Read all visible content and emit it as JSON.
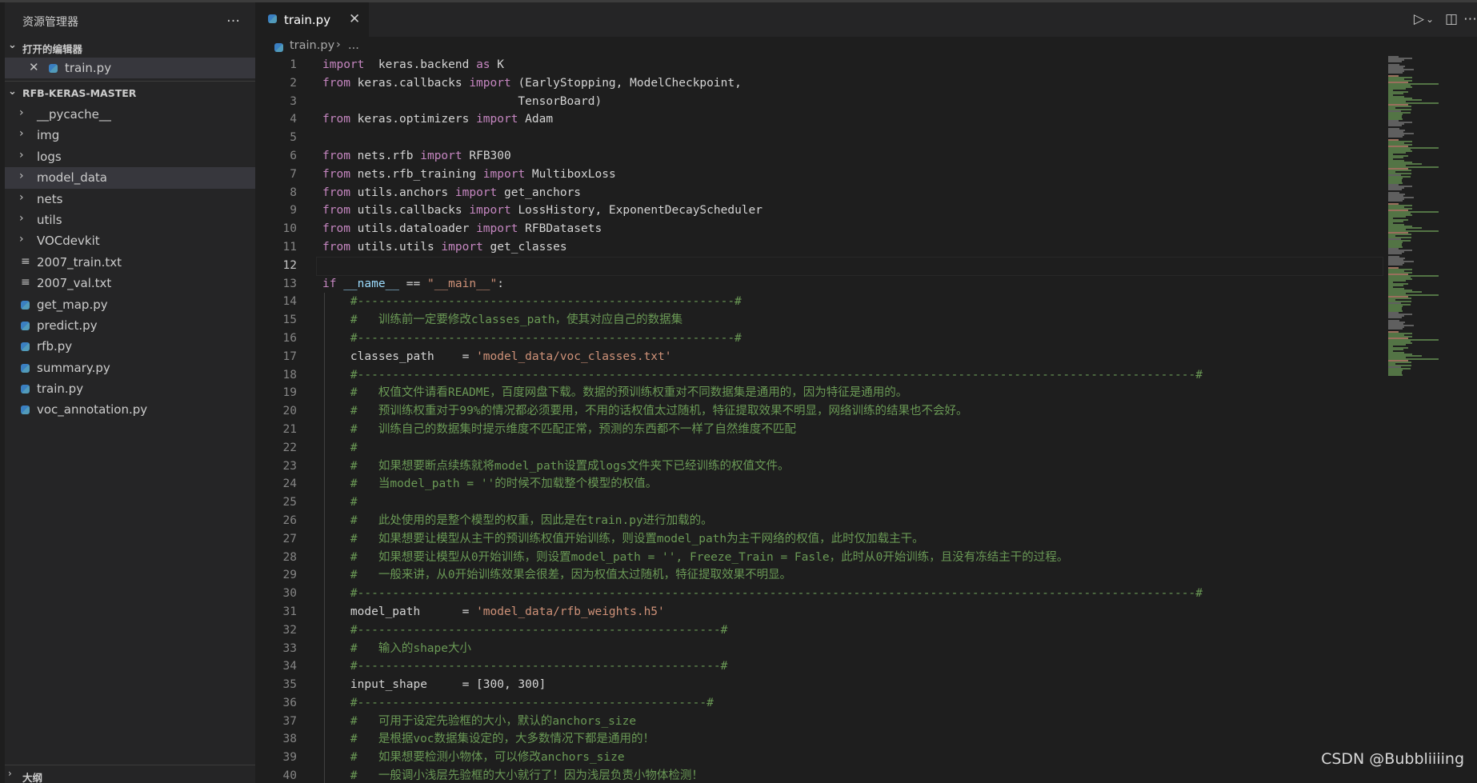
{
  "sidebar": {
    "title": "资源管理器",
    "more_icon": "…",
    "open_editors_label": "打开的编辑器",
    "open_editors": [
      {
        "name": "train.py"
      }
    ],
    "project_label": "RFB-KERAS-MASTER",
    "folders": [
      "__pycache__",
      "img",
      "logs",
      "model_data",
      "nets",
      "utils",
      "VOCdevkit"
    ],
    "files": [
      {
        "name": "2007_train.txt",
        "icon": "text-file-icon"
      },
      {
        "name": "2007_val.txt",
        "icon": "text-file-icon"
      },
      {
        "name": "get_map.py",
        "icon": "python-file-icon"
      },
      {
        "name": "predict.py",
        "icon": "python-file-icon"
      },
      {
        "name": "rfb.py",
        "icon": "python-file-icon"
      },
      {
        "name": "summary.py",
        "icon": "python-file-icon"
      },
      {
        "name": "train.py",
        "icon": "python-file-icon"
      },
      {
        "name": "voc_annotation.py",
        "icon": "python-file-icon"
      }
    ],
    "selected_item": "model_data",
    "outline_label": "大纲"
  },
  "editor": {
    "tab": {
      "label": "train.py",
      "close": "✕"
    },
    "breadcrumb": {
      "file": "train.py",
      "separator": "›",
      "more": "..."
    },
    "active_line": 12,
    "lines": [
      [
        [
          "kw2",
          "import"
        ],
        [
          "",
          "  keras.backend "
        ],
        [
          "kw2",
          "as"
        ],
        [
          "",
          " K"
        ]
      ],
      [
        [
          "kw2",
          "from"
        ],
        [
          "",
          " keras.callbacks "
        ],
        [
          "kw2",
          "import"
        ],
        [
          "",
          " (EarlyStopping, ModelCheckpoint,"
        ]
      ],
      [
        [
          "",
          "                            TensorBoard)"
        ]
      ],
      [
        [
          "kw2",
          "from"
        ],
        [
          "",
          " keras.optimizers "
        ],
        [
          "kw2",
          "import"
        ],
        [
          "",
          " Adam"
        ]
      ],
      [],
      [
        [
          "kw2",
          "from"
        ],
        [
          "",
          " nets.rfb "
        ],
        [
          "kw2",
          "import"
        ],
        [
          "",
          " RFB300"
        ]
      ],
      [
        [
          "kw2",
          "from"
        ],
        [
          "",
          " nets.rfb_training "
        ],
        [
          "kw2",
          "import"
        ],
        [
          "",
          " MultiboxLoss"
        ]
      ],
      [
        [
          "kw2",
          "from"
        ],
        [
          "",
          " utils.anchors "
        ],
        [
          "kw2",
          "import"
        ],
        [
          "",
          " get_anchors"
        ]
      ],
      [
        [
          "kw2",
          "from"
        ],
        [
          "",
          " utils.callbacks "
        ],
        [
          "kw2",
          "import"
        ],
        [
          "",
          " LossHistory, ExponentDecayScheduler"
        ]
      ],
      [
        [
          "kw2",
          "from"
        ],
        [
          "",
          " utils.dataloader "
        ],
        [
          "kw2",
          "import"
        ],
        [
          "",
          " RFBDatasets"
        ]
      ],
      [
        [
          "kw2",
          "from"
        ],
        [
          "",
          " utils.utils "
        ],
        [
          "kw2",
          "import"
        ],
        [
          "",
          " get_classes"
        ]
      ],
      [],
      [
        [
          "kw2",
          "if"
        ],
        [
          "",
          " "
        ],
        [
          "var",
          "__name__"
        ],
        [
          "",
          " == "
        ],
        [
          "str",
          "\"__main__\""
        ],
        [
          "",
          ":"
        ]
      ],
      [
        [
          "",
          "    "
        ],
        [
          "cm",
          "#------------------------------------------------------#"
        ]
      ],
      [
        [
          "",
          "    "
        ],
        [
          "cm",
          "#   训练前一定要修改classes_path，使其对应自己的数据集"
        ]
      ],
      [
        [
          "",
          "    "
        ],
        [
          "cm",
          "#------------------------------------------------------#"
        ]
      ],
      [
        [
          "",
          "    classes_path    = "
        ],
        [
          "str",
          "'model_data/voc_classes.txt'"
        ]
      ],
      [
        [
          "",
          "    "
        ],
        [
          "cm",
          "#------------------------------------------------------------------------------------------------------------------------#"
        ]
      ],
      [
        [
          "",
          "    "
        ],
        [
          "cm",
          "#   权值文件请看README，百度网盘下载。数据的预训练权重对不同数据集是通用的，因为特征是通用的。"
        ]
      ],
      [
        [
          "",
          "    "
        ],
        [
          "cm",
          "#   预训练权重对于99%的情况都必须要用，不用的话权值太过随机，特征提取效果不明显，网络训练的结果也不会好。"
        ]
      ],
      [
        [
          "",
          "    "
        ],
        [
          "cm",
          "#   训练自己的数据集时提示维度不匹配正常，预测的东西都不一样了自然维度不匹配"
        ]
      ],
      [
        [
          "",
          "    "
        ],
        [
          "cm",
          "#"
        ]
      ],
      [
        [
          "",
          "    "
        ],
        [
          "cm",
          "#   如果想要断点续练就将model_path设置成logs文件夹下已经训练的权值文件。"
        ]
      ],
      [
        [
          "",
          "    "
        ],
        [
          "cm",
          "#   当model_path = ''的时候不加载整个模型的权值。"
        ]
      ],
      [
        [
          "",
          "    "
        ],
        [
          "cm",
          "#"
        ]
      ],
      [
        [
          "",
          "    "
        ],
        [
          "cm",
          "#   此处使用的是整个模型的权重，因此是在train.py进行加载的。"
        ]
      ],
      [
        [
          "",
          "    "
        ],
        [
          "cm",
          "#   如果想要让模型从主干的预训练权值开始训练，则设置model_path为主干网络的权值，此时仅加载主干。"
        ]
      ],
      [
        [
          "",
          "    "
        ],
        [
          "cm",
          "#   如果想要让模型从0开始训练，则设置model_path = '', Freeze_Train = Fasle，此时从0开始训练，且没有冻结主干的过程。"
        ]
      ],
      [
        [
          "",
          "    "
        ],
        [
          "cm",
          "#   一般来讲，从0开始训练效果会很差，因为权值太过随机，特征提取效果不明显。"
        ]
      ],
      [
        [
          "",
          "    "
        ],
        [
          "cm",
          "#------------------------------------------------------------------------------------------------------------------------#"
        ]
      ],
      [
        [
          "",
          "    model_path      = "
        ],
        [
          "str",
          "'model_data/rfb_weights.h5'"
        ]
      ],
      [
        [
          "",
          "    "
        ],
        [
          "cm",
          "#----------------------------------------------------#"
        ]
      ],
      [
        [
          "",
          "    "
        ],
        [
          "cm",
          "#   输入的shape大小"
        ]
      ],
      [
        [
          "",
          "    "
        ],
        [
          "cm",
          "#----------------------------------------------------#"
        ]
      ],
      [
        [
          "",
          "    input_shape     = [300, 300]"
        ]
      ],
      [
        [
          "",
          "    "
        ],
        [
          "cm",
          "#--------------------------------------------------#"
        ]
      ],
      [
        [
          "",
          "    "
        ],
        [
          "cm",
          "#   可用于设定先验框的大小，默认的anchors_size"
        ]
      ],
      [
        [
          "",
          "    "
        ],
        [
          "cm",
          "#   是根据voc数据集设定的，大多数情况下都是通用的！"
        ]
      ],
      [
        [
          "",
          "    "
        ],
        [
          "cm",
          "#   如果想要检测小物体，可以修改anchors_size"
        ]
      ],
      [
        [
          "",
          "    "
        ],
        [
          "cm",
          "#   一般调小浅层先验框的大小就行了！因为浅层负责小物体检测！"
        ]
      ]
    ]
  },
  "watermark": "CSDN @Bubbliiiing",
  "colors": {
    "keyword": "#c586c0",
    "string": "#ce9178",
    "comment": "#6a9955",
    "variable": "#9cdcfe",
    "background": "#1e1e1e",
    "sidebar": "#252526"
  }
}
